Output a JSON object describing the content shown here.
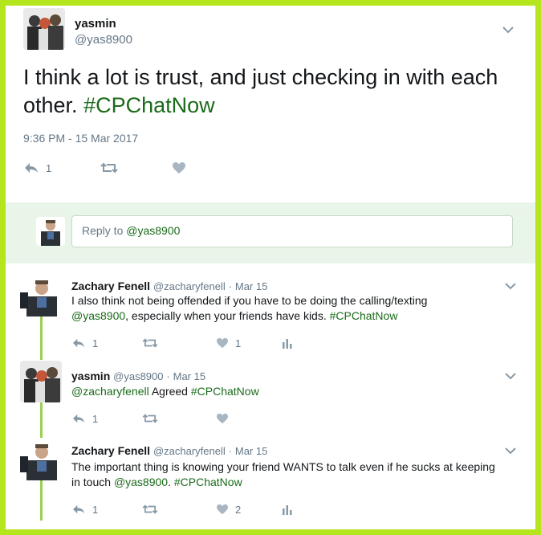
{
  "main_tweet": {
    "name": "yasmin",
    "handle": "@yas8900",
    "text": "I think a lot is trust, and just checking in with each other.",
    "hashtag": "#CPChatNow",
    "timestamp": "9:36 PM - 15 Mar 2017",
    "reply_count": "1"
  },
  "composer": {
    "prefix": "Reply to ",
    "mention": "@yas8900"
  },
  "replies": [
    {
      "name": "Zachary Fenell",
      "handle": "@zacharyfenell",
      "separator": "·",
      "date": "Mar 15",
      "text": "I also think not being offended if you have to be doing the calling/texting",
      "mention": "@yas8900",
      "text_after": ", especially when your friends have kids.",
      "hashtag": "#CPChatNow",
      "reply_count": "1",
      "like_count": "1"
    },
    {
      "name": "yasmin",
      "handle": "@yas8900",
      "separator": "·",
      "date": "Mar 15",
      "mention": "@zacharyfenell",
      "text": "Agreed",
      "hashtag": "#CPChatNow",
      "reply_count": "1"
    },
    {
      "name": "Zachary Fenell",
      "handle": "@zacharyfenell",
      "separator": "·",
      "date": "Mar 15",
      "text": "The important thing is knowing your friend WANTS to talk even if he sucks at keeping in touch",
      "mention": "@yas8900",
      "text_after": ".",
      "hashtag": "#CPChatNow",
      "reply_count": "1",
      "like_count": "2"
    }
  ],
  "icons": {
    "reply": "reply-icon",
    "retweet": "retweet-icon",
    "like": "heart-icon",
    "analytics": "analytics-icon",
    "menu": "chevron-down-icon"
  },
  "colors": {
    "border": "#b5e61d",
    "link": "#1a6b1a",
    "composer_bg": "#e8f5e8",
    "thread_line": "#9bcf52",
    "muted": "#657786"
  }
}
